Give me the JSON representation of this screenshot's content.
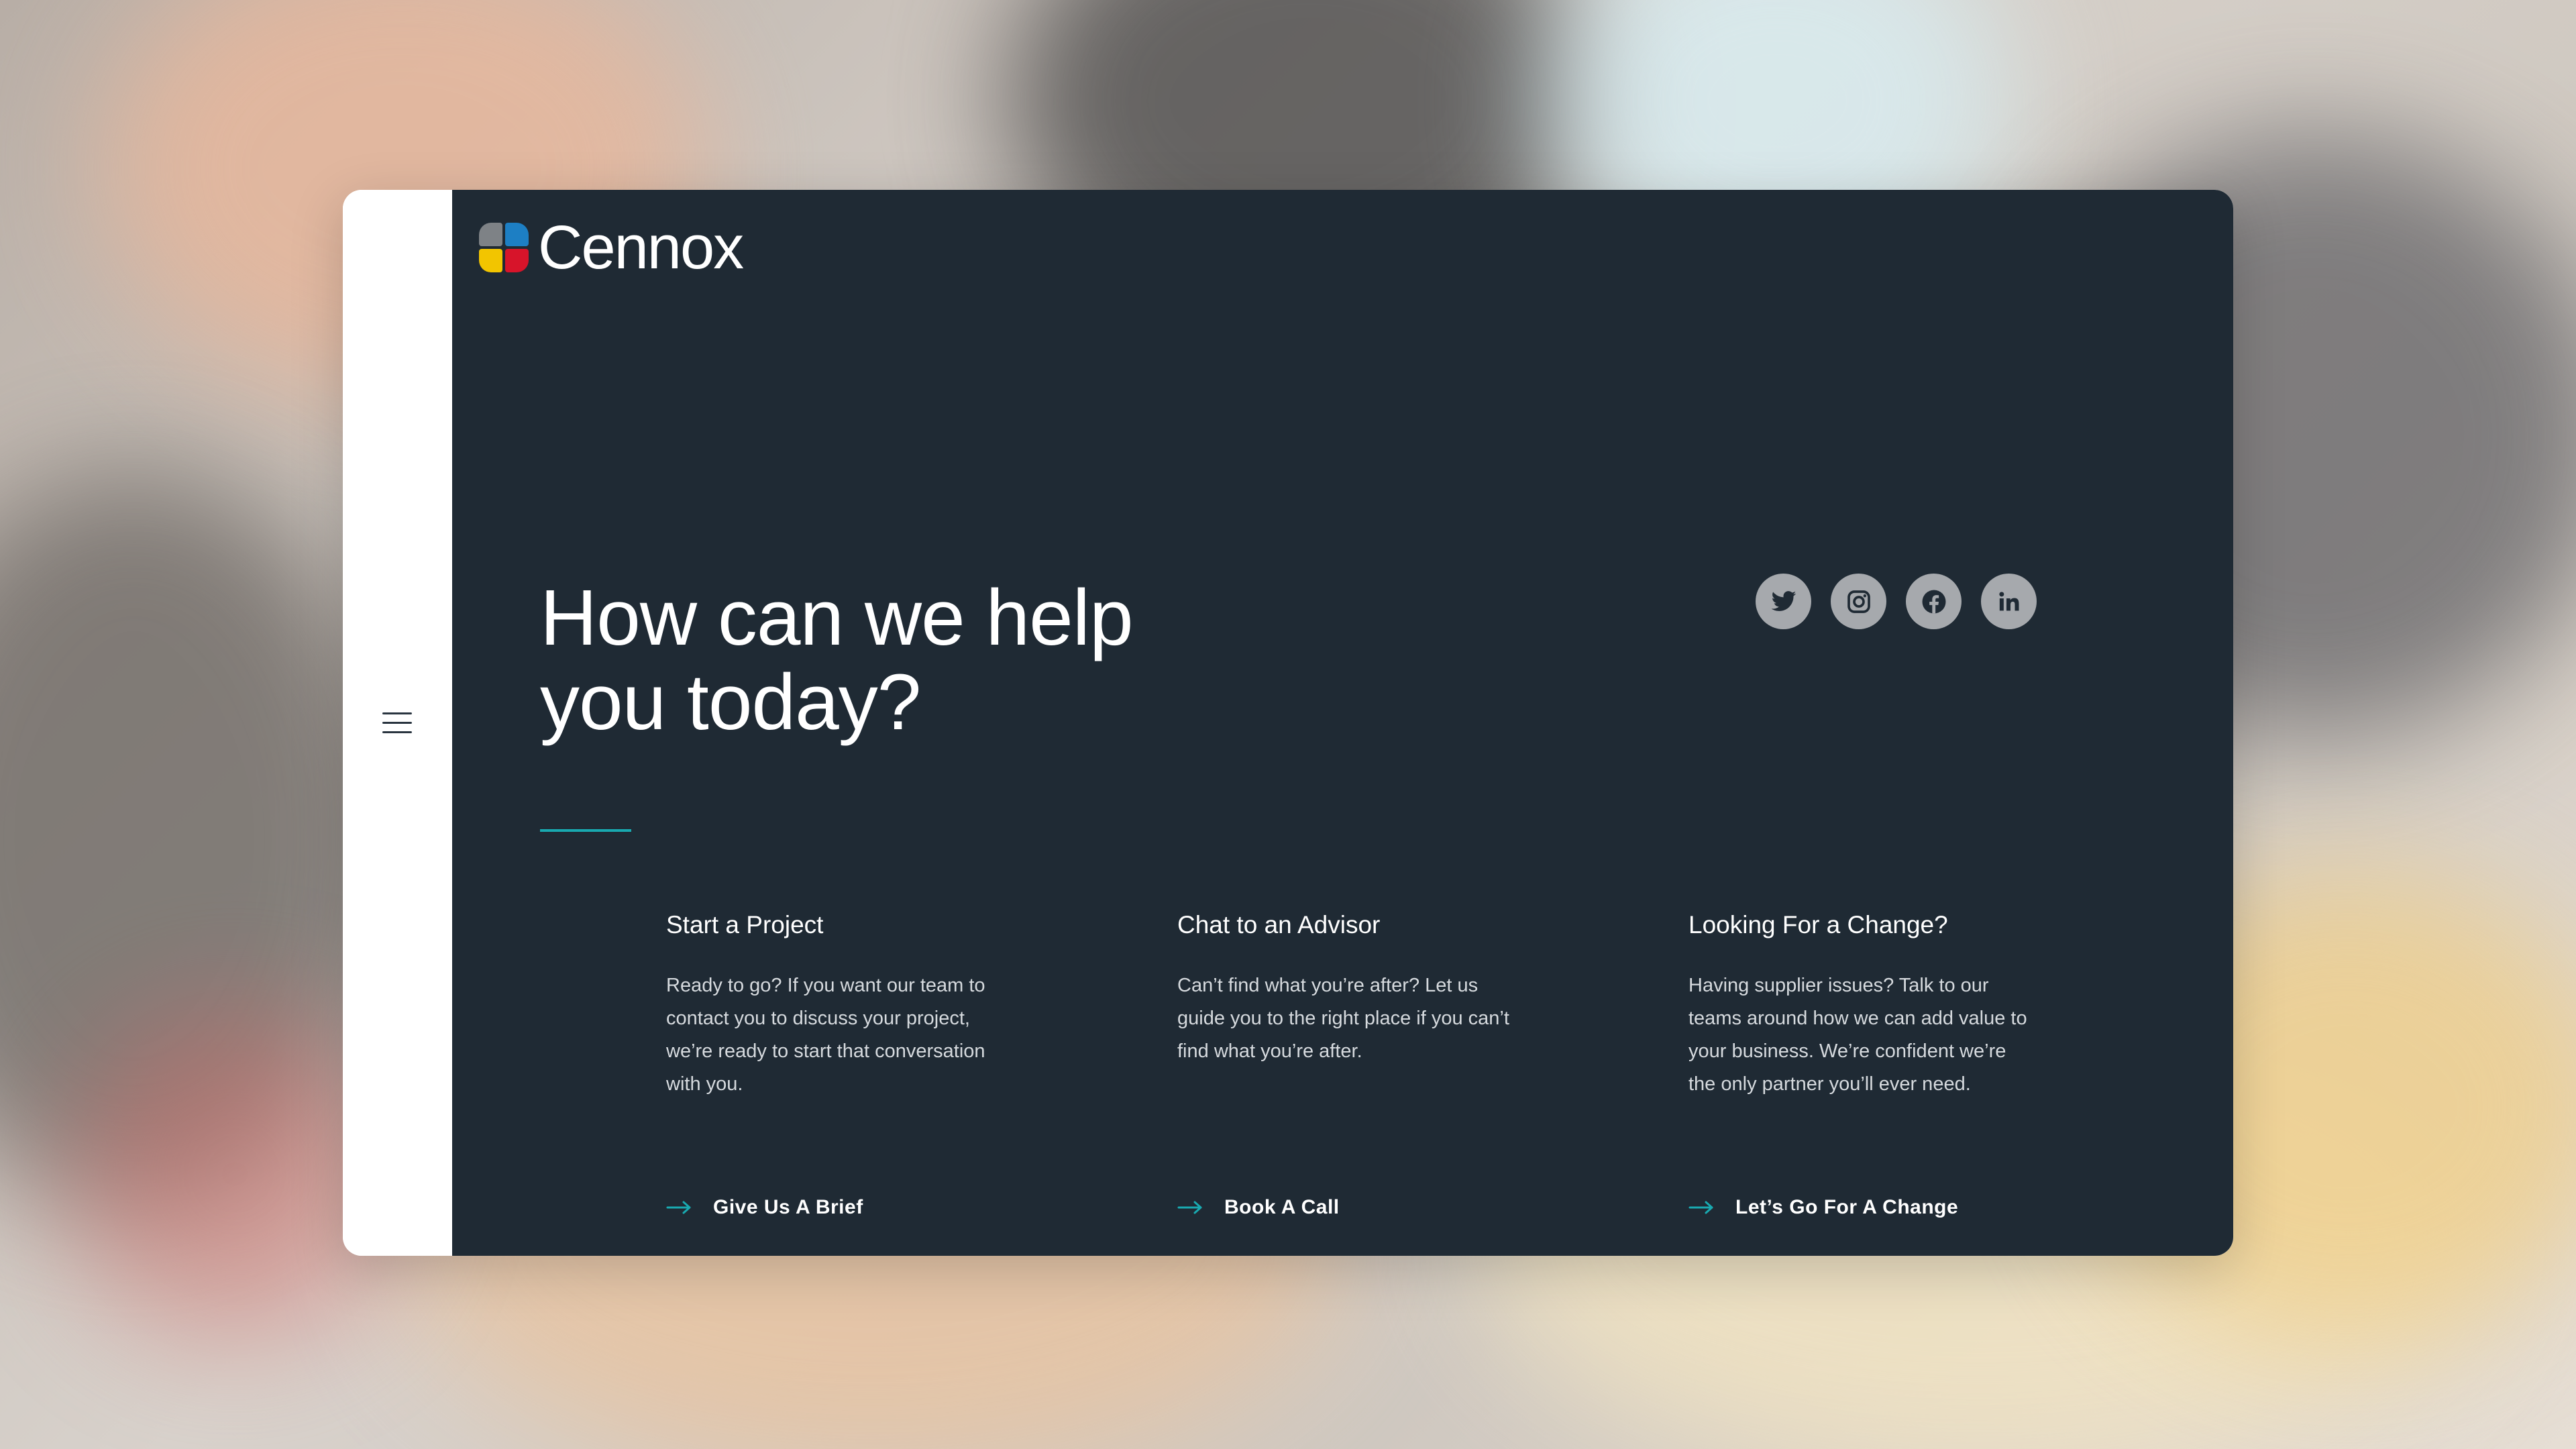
{
  "brand": {
    "name": "Cennox"
  },
  "hero": {
    "line1": "How can we help",
    "line2": "you today?"
  },
  "colors": {
    "panel": "#1f2a34",
    "accent": "#19a9b0",
    "social_bg": "#a6a9ad"
  },
  "social": [
    {
      "name": "twitter",
      "icon": "twitter-icon"
    },
    {
      "name": "instagram",
      "icon": "instagram-icon"
    },
    {
      "name": "facebook",
      "icon": "facebook-icon"
    },
    {
      "name": "linkedin",
      "icon": "linkedin-icon"
    }
  ],
  "cards": [
    {
      "title": "Start a Project",
      "body": "Ready to go? If you want our team to contact you to discuss your project, we’re ready to start that conversation with you.",
      "cta": "Give Us A Brief"
    },
    {
      "title": "Chat to an Advisor",
      "body": "Can’t find what you’re after? Let us guide you to the right place if you can’t find what you’re after.",
      "cta": "Book A Call"
    },
    {
      "title": "Looking For a Change?",
      "body": "Having supplier issues? Talk to our teams around how we can add value to your business. We’re confident we’re the only partner you’ll ever need.",
      "cta": "Let’s Go For A Change"
    }
  ]
}
